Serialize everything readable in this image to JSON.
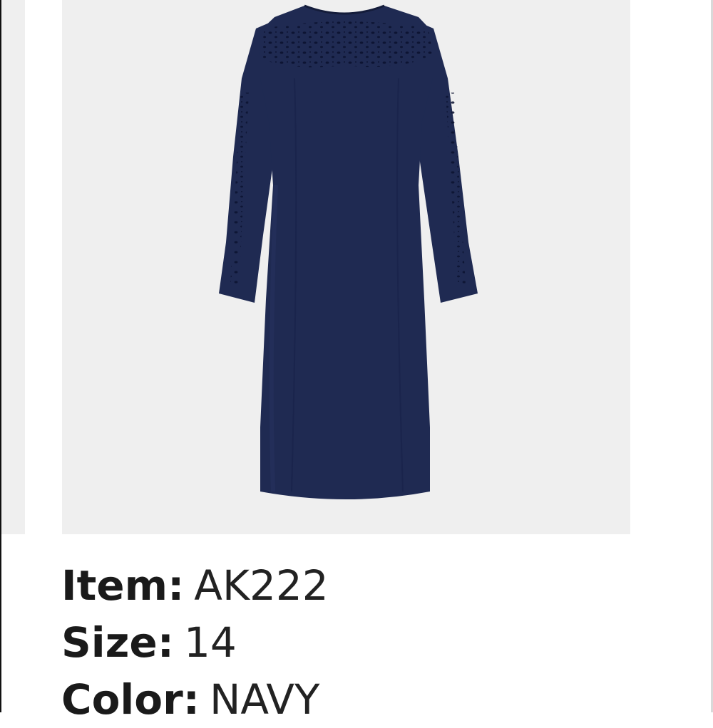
{
  "product": {
    "image": {
      "alt": "navy long-sleeve eyelet dress",
      "color_hex": "#1f2a52",
      "background_hex": "#efefef"
    },
    "details": [
      {
        "label": "Item:",
        "value": "AK222"
      },
      {
        "label": "Size:",
        "value": "14"
      },
      {
        "label": "Color:",
        "value": "NAVY"
      }
    ]
  }
}
